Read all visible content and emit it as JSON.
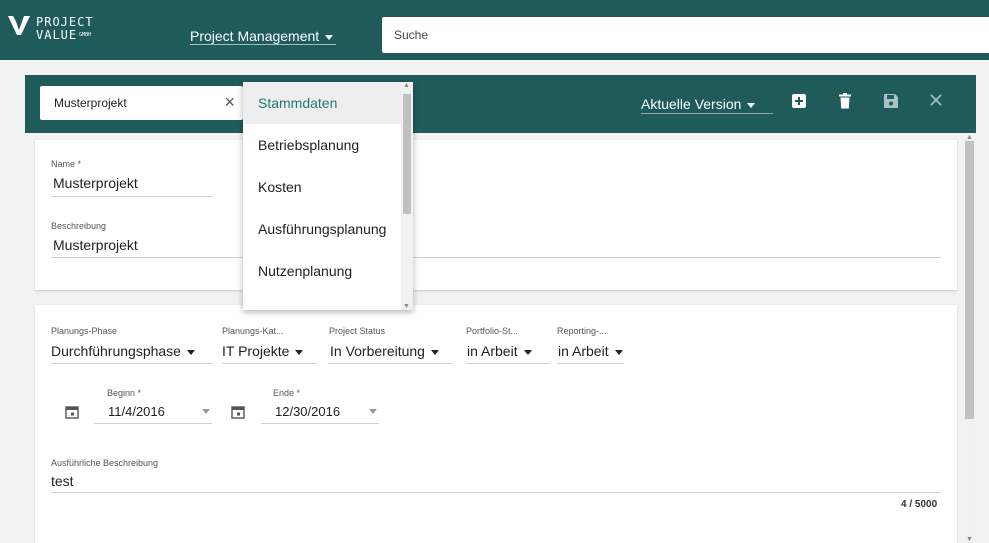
{
  "topbar": {
    "logo": {
      "line1": "PROJECT",
      "line2": "VALUE",
      "suffix": "GMBH"
    },
    "menu_label": "Project Management",
    "search": {
      "placeholder": "Suche",
      "value": ""
    }
  },
  "toolbar": {
    "project_select": "Musterprojekt",
    "clear_icon": "×",
    "version_label": "Aktuelle Version",
    "icons": [
      "plus-square-icon",
      "trash-icon",
      "save-icon",
      "close-icon"
    ]
  },
  "dropdown": {
    "items": [
      {
        "label": "Stammdaten",
        "active": true
      },
      {
        "label": "Betriebsplanung",
        "active": false
      },
      {
        "label": "Kosten",
        "active": false
      },
      {
        "label": "Ausführungsplanung",
        "active": false
      },
      {
        "label": "Nutzenplanung",
        "active": false
      }
    ]
  },
  "form": {
    "name": {
      "label": "Name *",
      "value": "Musterprojekt"
    },
    "beschreibung": {
      "label": "Beschreibung",
      "value": "Musterprojekt"
    },
    "fields": [
      {
        "label": "Planungs-Phase",
        "value": "Durchführungsphase"
      },
      {
        "label": "Planungs-Kat...",
        "value": "IT Projekte"
      },
      {
        "label": "Project Status",
        "value": "In Vorbereitung"
      },
      {
        "label": "Portfolio-St...",
        "value": "in Arbeit"
      },
      {
        "label": "Reporting-...",
        "value": "in Arbeit"
      }
    ],
    "beginn": {
      "label": "Beginn *",
      "value": "11/4/2016"
    },
    "ende": {
      "label": "Ende *",
      "value": "12/30/2016"
    },
    "ausfuehrlich": {
      "label": "Ausführliche Beschreibung",
      "value": "test",
      "counter": "4 / 5000"
    }
  },
  "colors": {
    "primary": "#1f5b5b",
    "accent": "#1f7a6d"
  }
}
